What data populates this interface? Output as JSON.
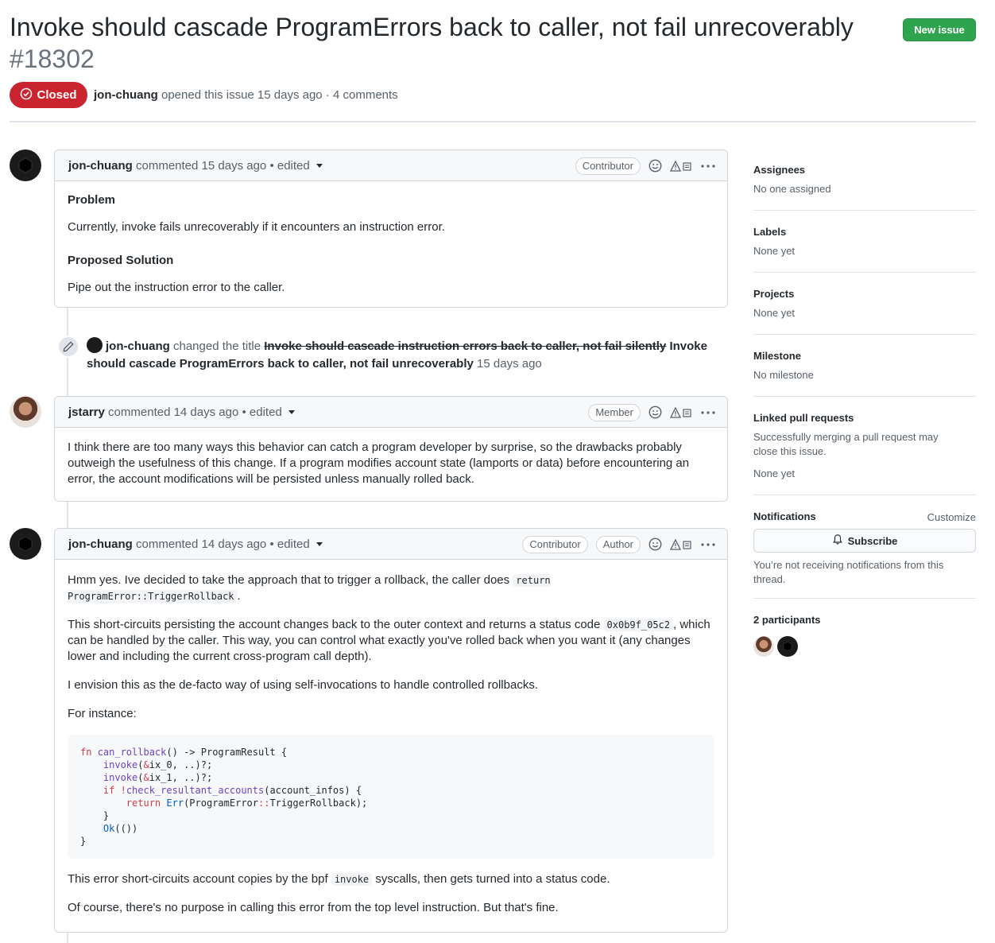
{
  "issue": {
    "title": "Invoke should cascade ProgramErrors back to caller, not fail unrecoverably",
    "number": "#18302",
    "status": "Closed",
    "author": "jon-chuang",
    "opened_text": "opened this issue 15 days ago · 4 comments",
    "new_issue_label": "New issue"
  },
  "comments": [
    {
      "author": "jon-chuang",
      "meta": "commented 15 days ago",
      "edited": "• edited",
      "roles": [
        "Contributor"
      ],
      "body": {
        "h1": "Problem",
        "p1": "Currently, invoke fails unrecoverably if it encounters an instruction error.",
        "h2": "Proposed Solution",
        "p2": "Pipe out the instruction error to the caller."
      }
    },
    {
      "author": "jstarry",
      "meta": "commented 14 days ago",
      "edited": "• edited",
      "roles": [
        "Member"
      ],
      "body": {
        "p1": "I think there are too many ways this behavior can catch a program developer by surprise, so the drawbacks probably outweigh the usefulness of this change. If a program modifies account state (lamports or data) before encountering an error, the account modifications will be persisted unless manually rolled back."
      }
    },
    {
      "author": "jon-chuang",
      "meta": "commented 14 days ago",
      "edited": "• edited",
      "roles": [
        "Contributor",
        "Author"
      ],
      "body": {
        "p1_a": "Hmm yes. Ive decided to take the approach that to trigger a rollback, the caller does ",
        "p1_code": "return ProgramError::TriggerRollback",
        "p1_b": ".",
        "p2_a": "This short-circuits persisting the account changes back to the outer context and returns a status code ",
        "p2_code": "0x0b9f_05c2",
        "p2_b": ", which can be handled by the caller. This way, you can control what exactly you've rolled back when you want it (any changes lower and including the current cross-program call depth).",
        "p3": "I envision this as the de-facto way of using self-invocations to handle controlled rollbacks.",
        "p4": "For instance:",
        "p5_a": "This error short-circuits account copies by the bpf ",
        "p5_code": "invoke",
        "p5_b": " syscalls, then gets turned into a status code.",
        "p6": "Of course, there's no purpose in calling this error from the top level instruction. But that's fine."
      }
    }
  ],
  "event": {
    "actor": "jon-chuang",
    "action": "changed the title",
    "old_title": "Invoke should cascade instruction errors back to caller, not fail silently",
    "new_title": "Invoke should cascade ProgramErrors back to caller, not fail unrecoverably",
    "time": "15 days ago"
  },
  "sidebar": {
    "assignees": {
      "label": "Assignees",
      "value": "No one assigned"
    },
    "labels": {
      "label": "Labels",
      "value": "None yet"
    },
    "projects": {
      "label": "Projects",
      "value": "None yet"
    },
    "milestone": {
      "label": "Milestone",
      "value": "No milestone"
    },
    "linked": {
      "label": "Linked pull requests",
      "desc": "Successfully merging a pull request may close this issue.",
      "value": "None yet"
    },
    "notifications": {
      "label": "Notifications",
      "customize": "Customize",
      "subscribe": "Subscribe",
      "desc": "You’re not receiving notifications from this thread."
    },
    "participants": {
      "label": "2 participants"
    }
  },
  "colors": {
    "closed": "#cb2431",
    "new_issue": "#2ea44f",
    "border": "#d1d5da"
  }
}
